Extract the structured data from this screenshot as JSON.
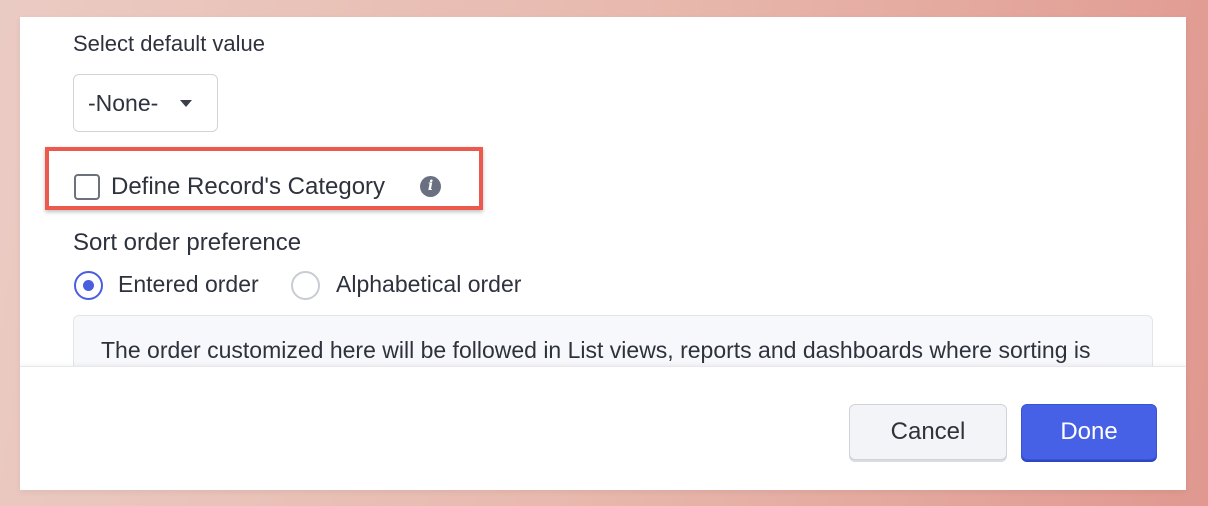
{
  "default_value": {
    "label": "Select default value",
    "selected": "-None-"
  },
  "record_category": {
    "label": "Define Record's Category",
    "checked": false,
    "info_icon": "info-icon"
  },
  "sort": {
    "heading": "Sort order preference",
    "options": [
      {
        "label": "Entered order",
        "selected": true
      },
      {
        "label": "Alphabetical order",
        "selected": false
      }
    ],
    "note": "The order customized here will be followed in List views, reports and dashboards where sorting is applied for the picklist field."
  },
  "footer": {
    "cancel_label": "Cancel",
    "done_label": "Done"
  },
  "colors": {
    "accent": "#4660e6",
    "highlight": "#ec5a4e"
  }
}
